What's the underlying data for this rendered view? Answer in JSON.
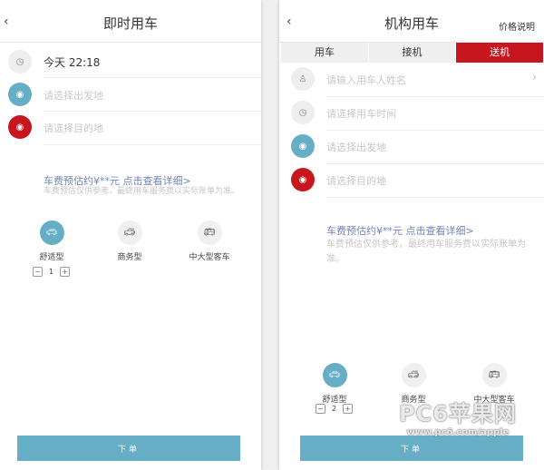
{
  "left": {
    "title": "即时用车",
    "back": "‹",
    "rows": [
      {
        "text": "今天 22:18",
        "icon": "clock-icon"
      },
      {
        "text": "请选择出发地",
        "icon": "location-pin-icon"
      },
      {
        "text": "请选择目的地",
        "icon": "location-pin-icon"
      }
    ],
    "estimate": "车费预估约¥**元 点击查看详细>",
    "note": "车费预估仅供参考，最终用车服务费以实际账单为准。",
    "cars": [
      {
        "label": "舒适型",
        "selected": true
      },
      {
        "label": "商务型"
      },
      {
        "label": "中大型客车"
      }
    ],
    "quantity": "1",
    "minus": "−",
    "plus": "+",
    "submit": "下单"
  },
  "right": {
    "title": "机构用车",
    "back": "‹",
    "price_link": "价格说明",
    "tabs": [
      {
        "label": "用车"
      },
      {
        "label": "接机"
      },
      {
        "label": "送机",
        "active": true
      }
    ],
    "rows": [
      {
        "text": "请输入用车人姓名",
        "icon": "person-icon"
      },
      {
        "text": "请选择用车时间",
        "icon": "clock-icon"
      },
      {
        "text": "请选择出发地",
        "icon": "location-pin-icon"
      },
      {
        "text": "请选择目的地",
        "icon": "location-pin-icon"
      }
    ],
    "chevron": "›",
    "estimate": "车费预估约¥**元 点击查看详细>",
    "note": "车费预估仅供参考，最终用车服务费以实际账单为准。",
    "cars": [
      {
        "label": "舒适型",
        "selected": true
      },
      {
        "label": "商务型"
      },
      {
        "label": "中大型客车"
      }
    ],
    "quantity": "2",
    "minus": "−",
    "plus": "+",
    "submit": "下单"
  },
  "watermark": {
    "brand": "PC6苹果网",
    "url": "www.pc6.com/apple"
  },
  "colors": {
    "accent_blue": "#66aec5",
    "accent_red": "#c8161e",
    "link": "#6f86b8"
  }
}
